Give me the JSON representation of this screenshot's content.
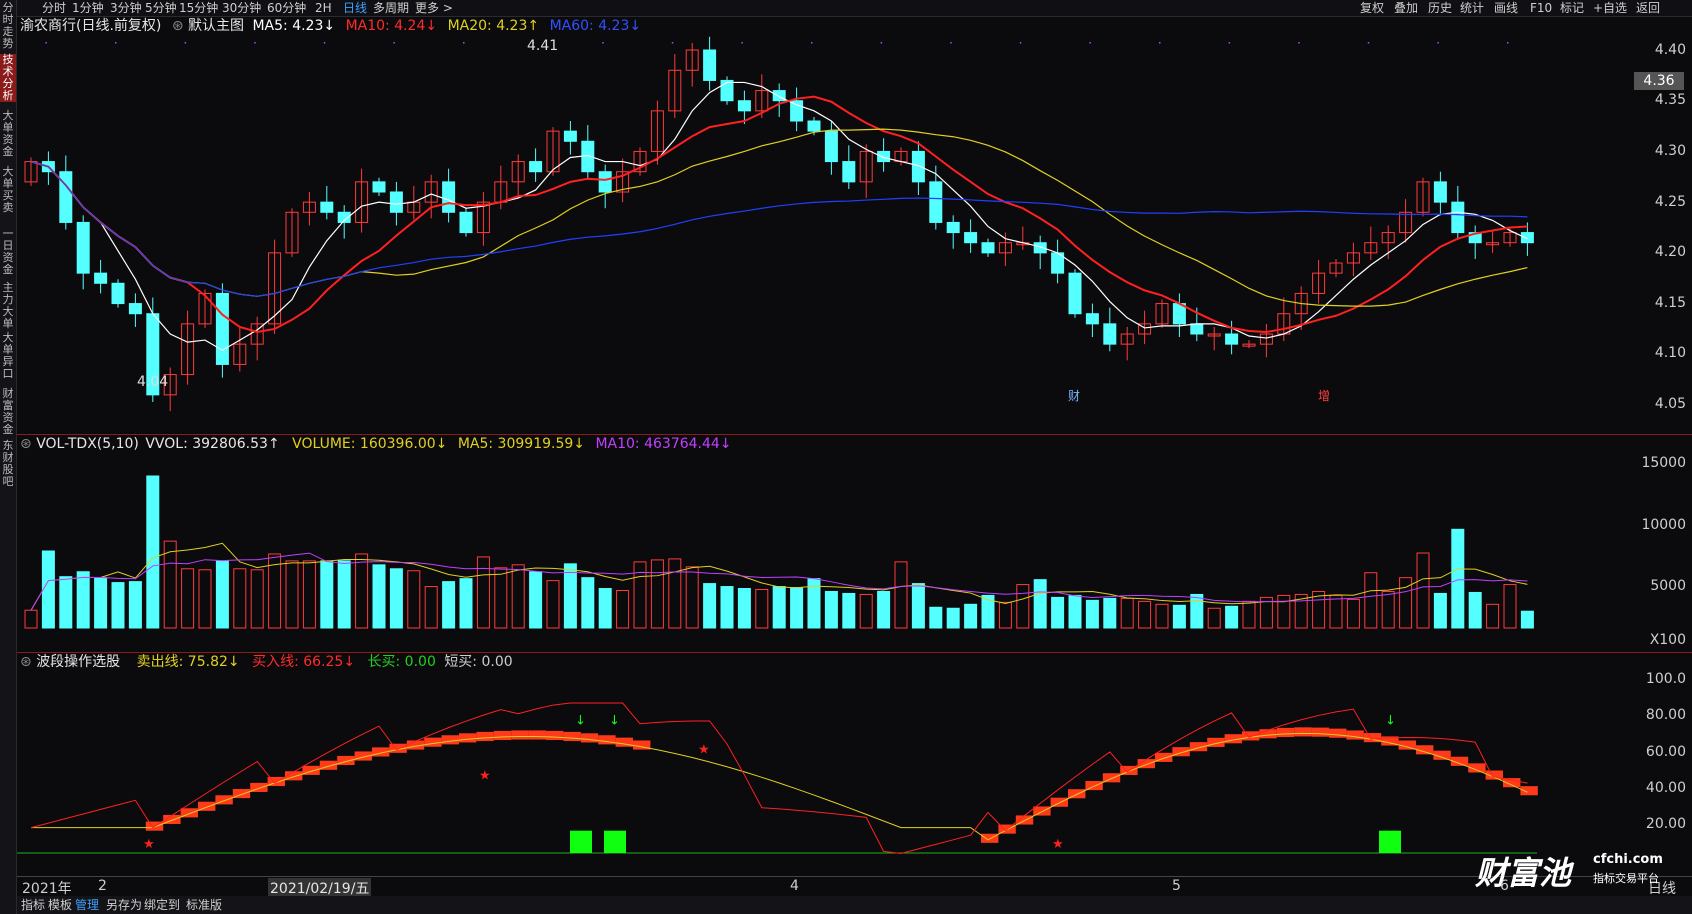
{
  "sidebar": {
    "tabs": [
      {
        "label": "分时走势",
        "active": false
      },
      {
        "label": "技术分析",
        "active": true
      },
      {
        "label": "大单资金",
        "active": false
      },
      {
        "label": "大单买卖",
        "active": false
      },
      {
        "label": "一日资金",
        "active": false
      },
      {
        "label": "主力大单",
        "active": false
      },
      {
        "label": "大单异口",
        "active": false
      },
      {
        "label": "财富资金",
        "active": false
      },
      {
        "label": "东财股吧",
        "active": false
      }
    ]
  },
  "toolbar": {
    "periods": [
      "分时",
      "1分钟",
      "3分钟",
      "5分钟",
      "15分钟",
      "30分钟",
      "60分钟",
      "2H",
      "日线",
      "多周期",
      "更多 >"
    ],
    "active_period": "日线",
    "right_buttons": [
      "复权",
      "叠加",
      "历史",
      "统计",
      "画线",
      "F10",
      "标记",
      "+自选",
      "返回"
    ]
  },
  "main_chart": {
    "stock": "渝农商行(日线.前复权)",
    "template": "默认主图",
    "ma5": "MA5: 4.23↓",
    "ma10": "MA10: 4.24↓",
    "ma20": "MA20: 4.23↑",
    "ma60": "MA60: 4.23↓",
    "high_label": "4.41",
    "low_label": "4.04",
    "current_price": "4.36",
    "axis": [
      "4.40",
      "4.35",
      "4.30",
      "4.25",
      "4.20",
      "4.15",
      "4.10",
      "4.05"
    ],
    "event_markers": [
      {
        "label": "财"
      },
      {
        "label": "增"
      }
    ]
  },
  "volume_chart": {
    "name": "VOL-TDX(5,10)",
    "vvol": "VVOL: 392806.53↑",
    "volume": "VOLUME: 160396.00↓",
    "ma5": "MA5: 309919.59↓",
    "ma10": "MA10: 463764.44↓",
    "axis": [
      "15000",
      "10000",
      "5000"
    ],
    "unit": "X100"
  },
  "indicator_chart": {
    "name": "波段操作选股",
    "sell": "卖出线: 75.82↓",
    "buy": "买入线: 66.25↓",
    "long": "长买: 0.00",
    "short": "短买: 0.00",
    "axis": [
      "100.0",
      "80.00",
      "60.00",
      "40.00",
      "20.00"
    ]
  },
  "date_axis": {
    "year": "2021年",
    "months": [
      "2",
      "4",
      "5",
      "6"
    ],
    "cursor_date": "2021/02/19/五",
    "period": "日线"
  },
  "bottombar": {
    "items": [
      "指标",
      "模板",
      "管理",
      "另存为",
      "绑定到",
      "标准版"
    ],
    "active": "管理"
  },
  "watermark": {
    "brand": "财富池",
    "domain": "cfchi.com",
    "slogan": "指标交易平台"
  },
  "colors": {
    "up": "#ff3b3b",
    "down": "#54ffff",
    "ma5": "#ffffff",
    "ma10": "#ff2020",
    "ma20": "#e0d020",
    "ma60": "#2040ff",
    "vol_ma5": "#e0d020",
    "vol_ma10": "#c040ff",
    "sell_line": "#e0d020",
    "buy_line": "#ff2020"
  }
}
